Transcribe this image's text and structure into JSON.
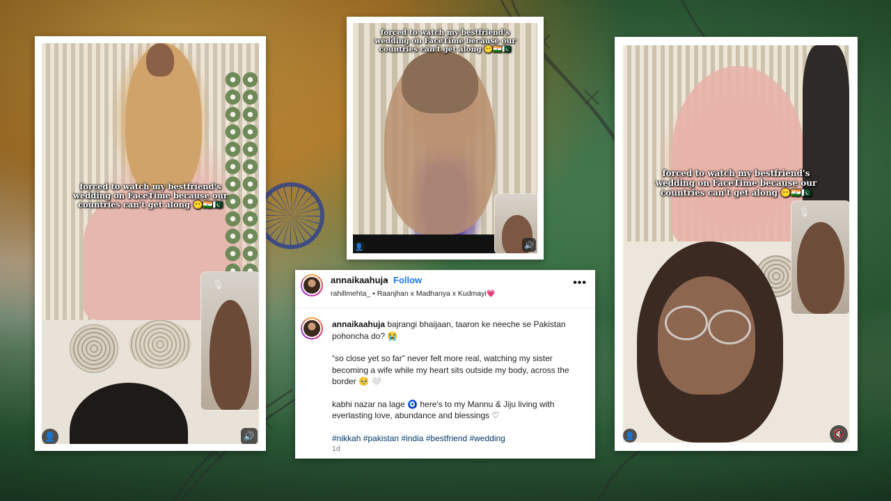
{
  "caption": {
    "line1": "forced to watch my bestfriend's",
    "line2": "wedding on FaceTime because our",
    "line3": "countries can't get along 😶🇮🇳🇵🇰"
  },
  "icons": {
    "profile": "👤",
    "mute": "🔇",
    "speaker": "🔊",
    "mic_off": "🎙"
  },
  "post": {
    "username": "annaikaahuja",
    "dot": "•",
    "follow_label": "Follow",
    "subtitle": "rahillmehta_ • Raanjhan x Madhanya x Kudmayi💗",
    "more": "•••",
    "comment_user": "annaikaahuja",
    "comment_text": "bajrangi bhaijaan, taaron ke neeche se Pakistan pohoncha do? 😭",
    "para2": "“so close yet so far” never felt more real, watching my sister becoming a wife while my heart sits outside my body, across the border 🥺 🤍",
    "para3": "kabhi nazar na lage 🧿 here's to my Mannu & Jiju living with everlasting love, abundance and blessings ♡",
    "hashtags": "#nikkah #pakistan #india #bestfriend #wedding",
    "time": "1d"
  },
  "colors": {
    "link_blue": "#1877f2",
    "hashtag_blue": "#00376b",
    "saffron": "#e9b24a",
    "green": "#2f6b3c",
    "chakra_blue": "#2c3f8f"
  }
}
